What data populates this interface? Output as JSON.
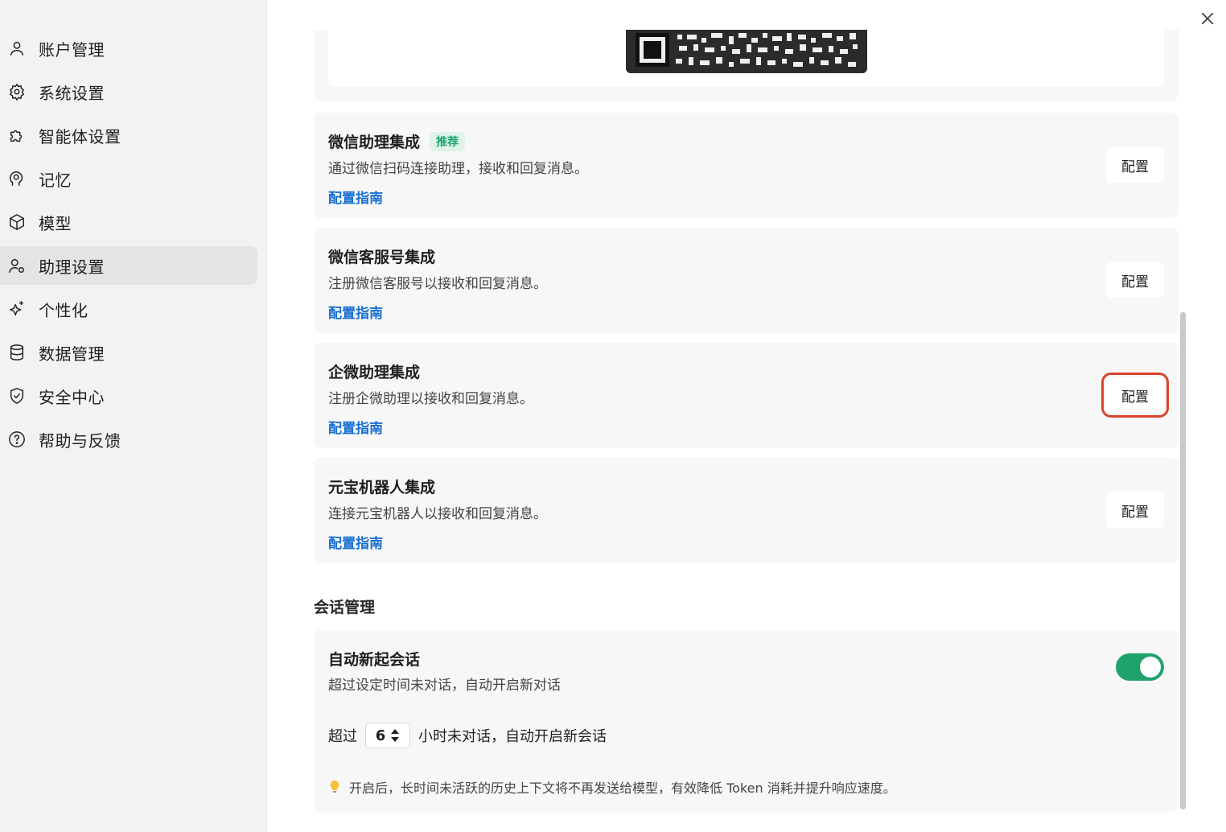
{
  "sidebar": {
    "items": [
      {
        "label": "账户管理",
        "icon": "user-icon"
      },
      {
        "label": "系统设置",
        "icon": "gear-icon"
      },
      {
        "label": "智能体设置",
        "icon": "puzzle-icon"
      },
      {
        "label": "记忆",
        "icon": "brain-icon"
      },
      {
        "label": "模型",
        "icon": "cube-icon"
      },
      {
        "label": "助理设置",
        "icon": "user-settings-icon",
        "active": true
      },
      {
        "label": "个性化",
        "icon": "sparkle-icon"
      },
      {
        "label": "数据管理",
        "icon": "database-icon"
      },
      {
        "label": "安全中心",
        "icon": "shield-icon"
      },
      {
        "label": "帮助与反馈",
        "icon": "help-icon"
      }
    ]
  },
  "integrations": [
    {
      "title": "微信助理集成",
      "badge": "推荐",
      "desc": "通过微信扫码连接助理，接收和回复消息。",
      "guide": "配置指南",
      "button": "配置"
    },
    {
      "title": "微信客服号集成",
      "desc": "注册微信客服号以接收和回复消息。",
      "guide": "配置指南",
      "button": "配置"
    },
    {
      "title": "企微助理集成",
      "desc": "注册企微助理以接收和回复消息。",
      "guide": "配置指南",
      "button": "配置"
    },
    {
      "title": "元宝机器人集成",
      "desc": "连接元宝机器人以接收和回复消息。",
      "guide": "配置指南",
      "button": "配置"
    }
  ],
  "session": {
    "section_title": "会话管理",
    "title": "自动新起会话",
    "desc": "超过设定时间未对话，自动开启新对话",
    "toggle_on": true,
    "row_prefix": "超过",
    "hours": "6",
    "row_suffix": "小时未对话，自动开启新会话",
    "tip": "开启后，长时间未活跃的历史上下文将不再发送给模型，有效降低 Token 消耗并提升响应速度。"
  },
  "colors": {
    "accent": "#1fa36c",
    "link": "#1a6fd1",
    "highlight": "#d9442c"
  }
}
